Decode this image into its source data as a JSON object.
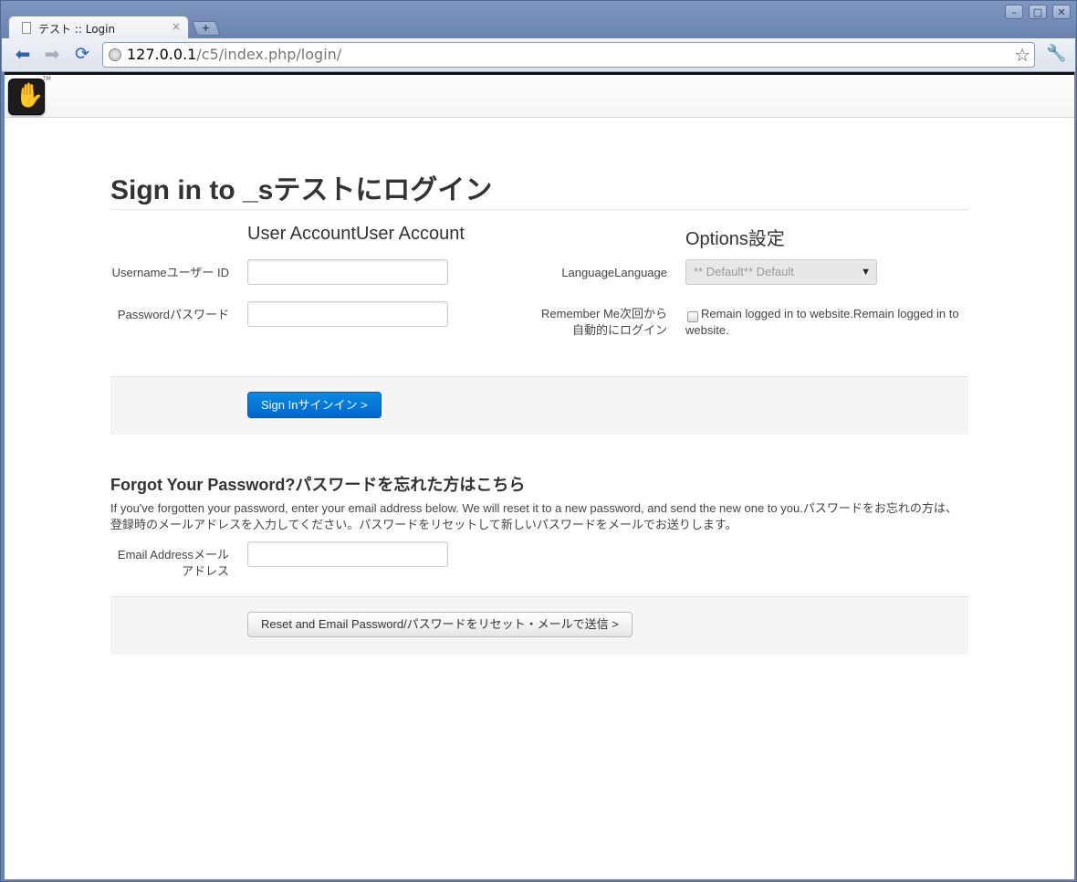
{
  "browser": {
    "tab_title": "テスト :: Login",
    "tab_close": "×",
    "new_tab": "+",
    "url_host": "127.0.0.1",
    "url_path": "/c5/index.php/login/",
    "window_buttons": [
      "–",
      "□",
      "✕"
    ]
  },
  "site": {
    "logo_tm": "TM"
  },
  "login": {
    "title": "Sign in to _sテストにログイン",
    "account_legend": "User AccountUser Account",
    "options_legend": "Options設定",
    "username_label": "Usernameユーザー ID",
    "password_label": "Passwordパスワード",
    "language_label": "LanguageLanguage",
    "language_value": "** Default** Default",
    "remember_label": "Remember Me次回から自動的にログイン",
    "remember_text": "Remain logged in to website.Remain logged in to website.",
    "remember_checked": false,
    "submit_label": "Sign Inサインイン >"
  },
  "forgot": {
    "title": "Forgot Your Password?パスワードを忘れた方はこちら",
    "help": "If you've forgotten your password, enter your email address below. We will reset it to a new password, and send the new one to you.パスワードをお忘れの方は、登録時のメールアドレスを入力してください。パスワードをリセットして新しいパスワードをメールでお送りします。",
    "email_label": "Email Addressメールアドレス",
    "reset_label": "Reset and Email Password/パスワードをリセット・メールで送信 >"
  }
}
